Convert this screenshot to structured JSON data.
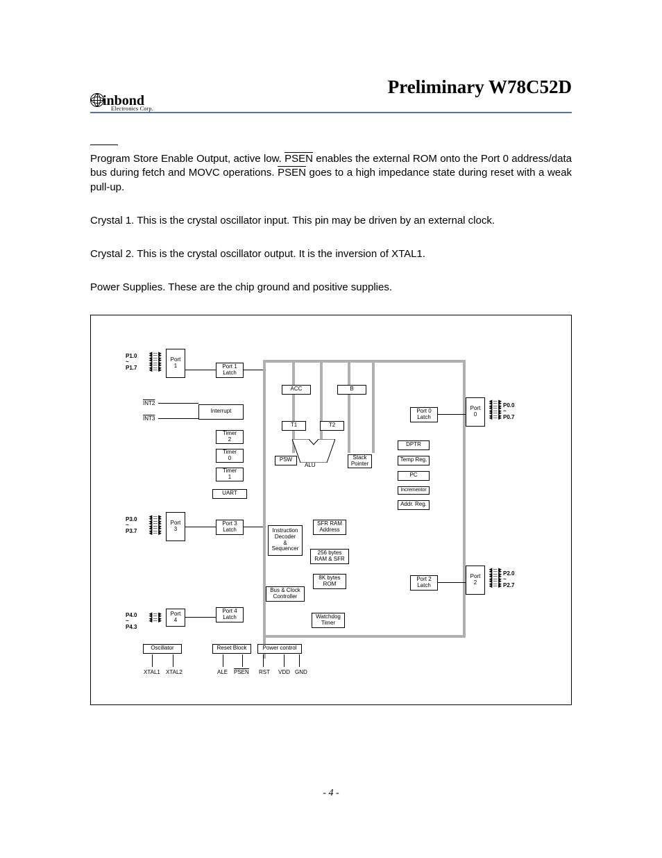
{
  "title": "Preliminary W78C52D",
  "logo": {
    "name": "inbond",
    "sub": "Electronics Corp."
  },
  "psen": {
    "pre": "Program Store Enable Output, active low. ",
    "sig1": "PSEN",
    "mid": " enables the external ROM onto the Port 0 address/data bus during fetch and MOVC operations. ",
    "sig2": "PSEN",
    "post": " goes to a high impedance state during reset with a weak pull-up."
  },
  "xtal1": "Crystal 1. This is the crystal oscillator input. This pin may be driven by an external clock.",
  "xtal2": "Crystal 2. This is the crystal oscillator output. It is the inversion of XTAL1.",
  "power": "Power Supplies. These are the chip ground and positive supplies.",
  "diagram": {
    "port1": "Port\n1",
    "port1latch": "Port 1\nLatch",
    "p1r": "P1.0\n~\nP1.7",
    "int2": "INT2",
    "int3": "INT3",
    "interrupt": "Interrupt",
    "timer2": "Timer\n2",
    "timer0": "Timer\n0",
    "timer1": "Timer\n1",
    "uart": "UART",
    "port3": "Port\n3",
    "port3latch": "Port 3\nLatch",
    "p3r": "P3.0\n~\nP3.7",
    "port4": "Port\n4",
    "port4latch": "Port 4\nLatch",
    "p4r": "P4.0\n~\nP4.3",
    "acc": "ACC",
    "b": "B",
    "t1": "T1",
    "t2": "T2",
    "psw": "PSW",
    "alu": "ALU",
    "sp": "Stack\nPointer",
    "instr": "Instruction\nDecoder\n&\nSequencer",
    "sfr": "SFR RAM\nAddress",
    "ram": "256 bytes\nRAM & SFR",
    "rom": "8K bytes\nROM",
    "bus": "Bus & Clock\nController",
    "wdt": "Watchdog\nTimer",
    "osc": "Oscillator",
    "reset": "Reset Block",
    "pwr": "Power control",
    "port0": "Port\n0",
    "port0latch": "Port 0\nLatch",
    "p0r": "P0.0\n~\nP0.7",
    "dptr": "DPTR",
    "temp": "Temp Reg.",
    "pc": "PC",
    "incr": "Incrementor",
    "addr": "Addr. Reg.",
    "port2": "Port\n2",
    "port2latch": "Port 2\nLatch",
    "p2r": "P2.0\n~\nP2.7",
    "xtal1l": "XTAL1",
    "xtal2l": "XTAL2",
    "ale": "ALE",
    "psenl": "PSEN",
    "rst": "RST",
    "vdd": "VDD",
    "gnd": "GND"
  },
  "page_num": "- 4 -"
}
